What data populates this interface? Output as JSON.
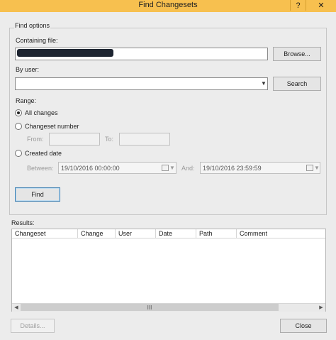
{
  "window": {
    "title": "Find Changesets",
    "help_glyph": "?",
    "close_glyph": "✕"
  },
  "find_options": {
    "legend": "Find options",
    "containing_file_label": "Containing file:",
    "browse_label": "Browse...",
    "by_user_label": "By user:",
    "search_label": "Search",
    "range_label": "Range:",
    "all_changes_label": "All changes",
    "changeset_number_label": "Changeset number",
    "from_label": "From:",
    "to_label": "To:",
    "created_date_label": "Created date",
    "between_label": "Between:",
    "between_value": "19/10/2016 00:00:00",
    "and_label": "And:",
    "and_value": "19/10/2016 23:59:59",
    "find_label": "Find",
    "selected_range": "All changes"
  },
  "results": {
    "label": "Results:",
    "columns": [
      "Changeset",
      "Change",
      "User",
      "Date",
      "Path",
      "Comment"
    ],
    "rows": [],
    "scroll_left": "◀",
    "scroll_right": "▶",
    "scroll_grip": "III"
  },
  "footer": {
    "details_label": "Details...",
    "close_label": "Close"
  },
  "colors": {
    "titlebar": "#f7c04f",
    "dialog_bg": "#ececec"
  }
}
